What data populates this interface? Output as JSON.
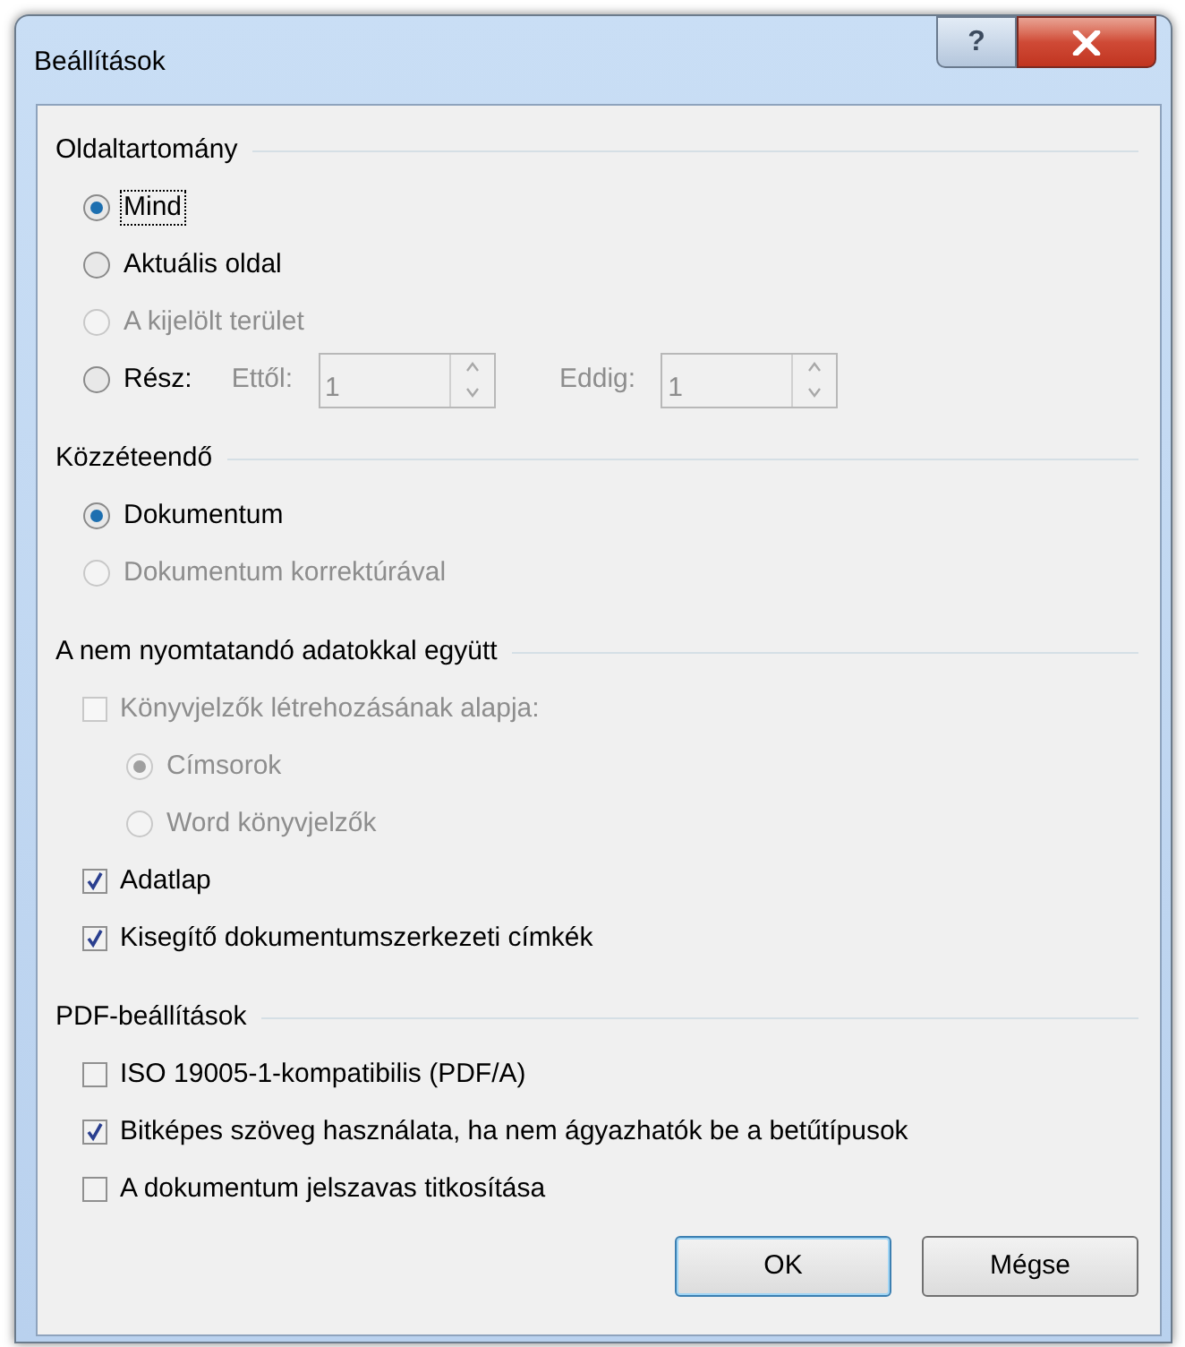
{
  "window": {
    "title": "Beállítások",
    "help_button": "?"
  },
  "sections": [
    {
      "title": "Oldaltartomány",
      "items": [
        {
          "kind": "radio",
          "label": "Mind",
          "selected": true,
          "disabled": false,
          "focused": true
        },
        {
          "kind": "radio",
          "label": "Aktuális oldal",
          "selected": false,
          "disabled": false,
          "focused": false
        },
        {
          "kind": "radio",
          "label": "A kijelölt terület",
          "selected": false,
          "disabled": true,
          "focused": false
        },
        {
          "kind": "range",
          "label": "Rész:",
          "selected": false,
          "disabled": false,
          "focused": false,
          "from_label": "Ettől:",
          "from_value": "1",
          "to_label": "Eddig:",
          "to_value": "1",
          "fields_disabled": true
        }
      ]
    },
    {
      "title": "Közzéteendő",
      "items": [
        {
          "kind": "radio",
          "label": "Dokumentum",
          "selected": true,
          "disabled": false,
          "focused": false
        },
        {
          "kind": "radio",
          "label": "Dokumentum korrektúrával",
          "selected": false,
          "disabled": true,
          "focused": false
        }
      ]
    },
    {
      "title": "A nem nyomtatandó adatokkal együtt",
      "items": [
        {
          "kind": "checkbox",
          "label": "Könyvjelzők létrehozásának alapja:",
          "checked": false,
          "disabled": true,
          "focused": false,
          "children": [
            {
              "kind": "radio",
              "label": "Címsorok",
              "selected": true,
              "disabled": true,
              "focused": false
            },
            {
              "kind": "radio",
              "label": "Word könyvjelzők",
              "selected": false,
              "disabled": true,
              "focused": false
            }
          ]
        },
        {
          "kind": "checkbox",
          "label": "Adatlap",
          "checked": true,
          "disabled": false,
          "focused": false
        },
        {
          "kind": "checkbox",
          "label": "Kisegítő dokumentumszerkezeti címkék",
          "checked": true,
          "disabled": false,
          "focused": false
        }
      ]
    },
    {
      "title": "PDF-beállítások",
      "items": [
        {
          "kind": "checkbox",
          "label": "ISO 19005-1-kompatibilis (PDF/A)",
          "checked": false,
          "disabled": false,
          "focused": false
        },
        {
          "kind": "checkbox",
          "label": "Bitképes szöveg használata, ha nem ágyazhatók be a betűtípusok",
          "checked": true,
          "disabled": false,
          "focused": false
        },
        {
          "kind": "checkbox",
          "label": "A dokumentum jelszavas titkosítása",
          "checked": false,
          "disabled": false,
          "focused": false
        }
      ]
    }
  ],
  "buttons": [
    {
      "label": "OK",
      "default": true
    },
    {
      "label": "Mégse",
      "default": false
    }
  ]
}
